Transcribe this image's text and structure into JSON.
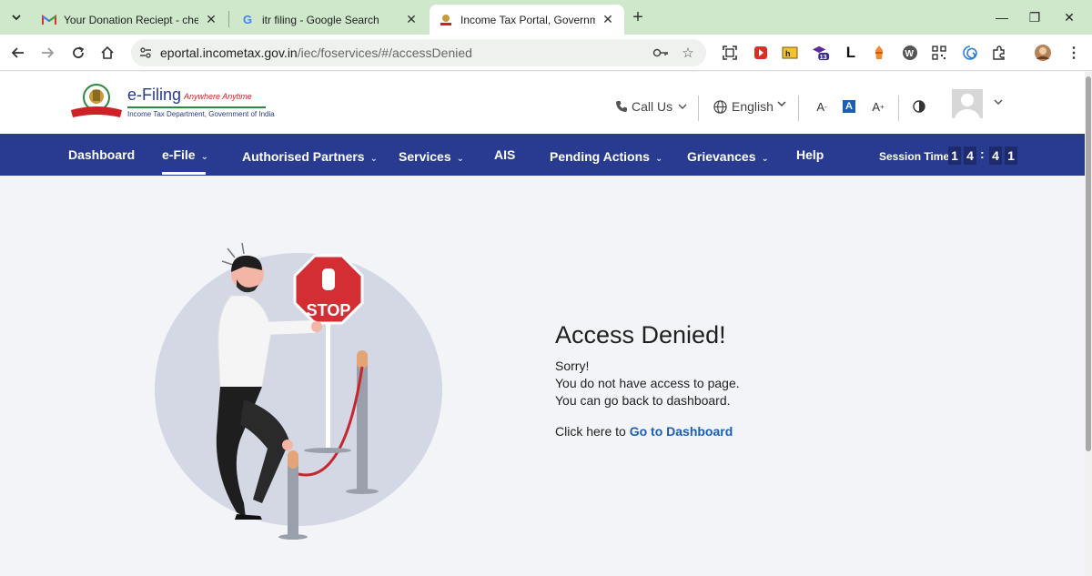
{
  "browser": {
    "tabs": [
      {
        "title": "Your Donation Reciept - chetha",
        "favicon": "gmail-icon",
        "active": false
      },
      {
        "title": "itr filing - Google Search",
        "favicon": "google-icon",
        "active": false
      },
      {
        "title": "Income Tax Portal, Government",
        "favicon": "income-tax-emblem-icon",
        "active": true
      }
    ],
    "url_domain": "eportal.incometax.gov.in",
    "url_path": "/iec/foservices/#/accessDenied",
    "extensions": {
      "count_badge": "13",
      "letter_ext": "L"
    }
  },
  "header": {
    "logo": {
      "brand": "e-Filing",
      "tagline": "Anywhere Anytime",
      "department": "Income Tax Department, Government of India"
    },
    "call_us": "Call Us",
    "language": "English",
    "font_decrease": "A",
    "font_reset": "A",
    "font_increase": "A"
  },
  "nav": {
    "items": [
      {
        "label": "Dashboard"
      },
      {
        "label": "e-File"
      },
      {
        "label": "Authorised Partners"
      },
      {
        "label": "Services"
      },
      {
        "label": "AIS"
      },
      {
        "label": "Pending Actions"
      },
      {
        "label": "Grievances"
      },
      {
        "label": "Help"
      }
    ],
    "session_label": "Session Time",
    "session_digits": [
      "1",
      "4",
      "4",
      "1"
    ]
  },
  "main": {
    "stop_sign": "STOP",
    "title": "Access Denied!",
    "lines": [
      "Sorry!",
      "You do not have access to page.",
      "You can go back to dashboard."
    ],
    "click_prefix": "Click here to",
    "dashboard_link": "Go to Dashboard"
  },
  "colors": {
    "nav_bg": "#283b91",
    "link": "#1b5fb4",
    "tabstrip": "#cfe8cc",
    "stop_red": "#d42e35"
  }
}
